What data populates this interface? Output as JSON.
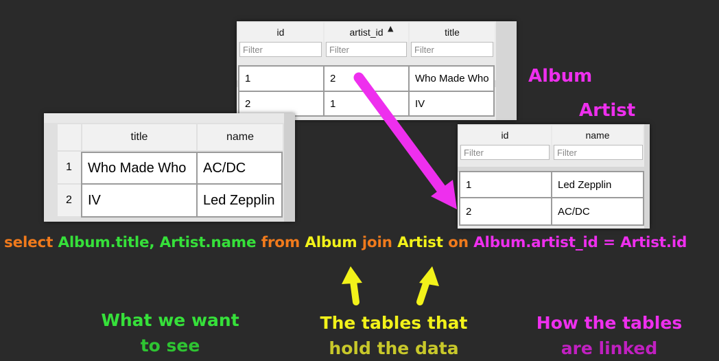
{
  "album_table": {
    "columns": [
      "id",
      "artist_id",
      "title"
    ],
    "filter_placeholder": "Filter",
    "rows": [
      [
        "1",
        "2",
        "Who Made Who"
      ],
      [
        "2",
        "1",
        "IV"
      ]
    ]
  },
  "album_label": "Album",
  "artist_label": "Artist",
  "artist_table": {
    "columns": [
      "id",
      "name"
    ],
    "filter_placeholder": "Filter",
    "rows": [
      [
        "1",
        "Led Zepplin"
      ],
      [
        "2",
        "AC/DC"
      ]
    ]
  },
  "result_table": {
    "columns": [
      "title",
      "name"
    ],
    "rows": [
      [
        "1",
        "Who Made Who",
        "AC/DC"
      ],
      [
        "2",
        "IV",
        "Led Zepplin"
      ]
    ]
  },
  "sql": {
    "kw_select": "select",
    "fields": "Album.title, Artist.name",
    "kw_from": "from",
    "table1": "Album",
    "kw_join": "join",
    "table2": "Artist",
    "kw_on": "on",
    "condition": "Album.artist_id = Artist.id"
  },
  "captions": {
    "want_line1": "What we want",
    "want_line2": "to see",
    "tables_line1": "The tables that",
    "tables_line2": "hold the data",
    "linked_line1": "How the tables",
    "linked_line2": "are linked"
  },
  "colors": {
    "orange": "#f07a1c",
    "green": "#36e03a",
    "yellow": "#f2f21a",
    "magenta": "#ee2fee",
    "olive": "#c8c82a",
    "purple": "#c020c0"
  }
}
